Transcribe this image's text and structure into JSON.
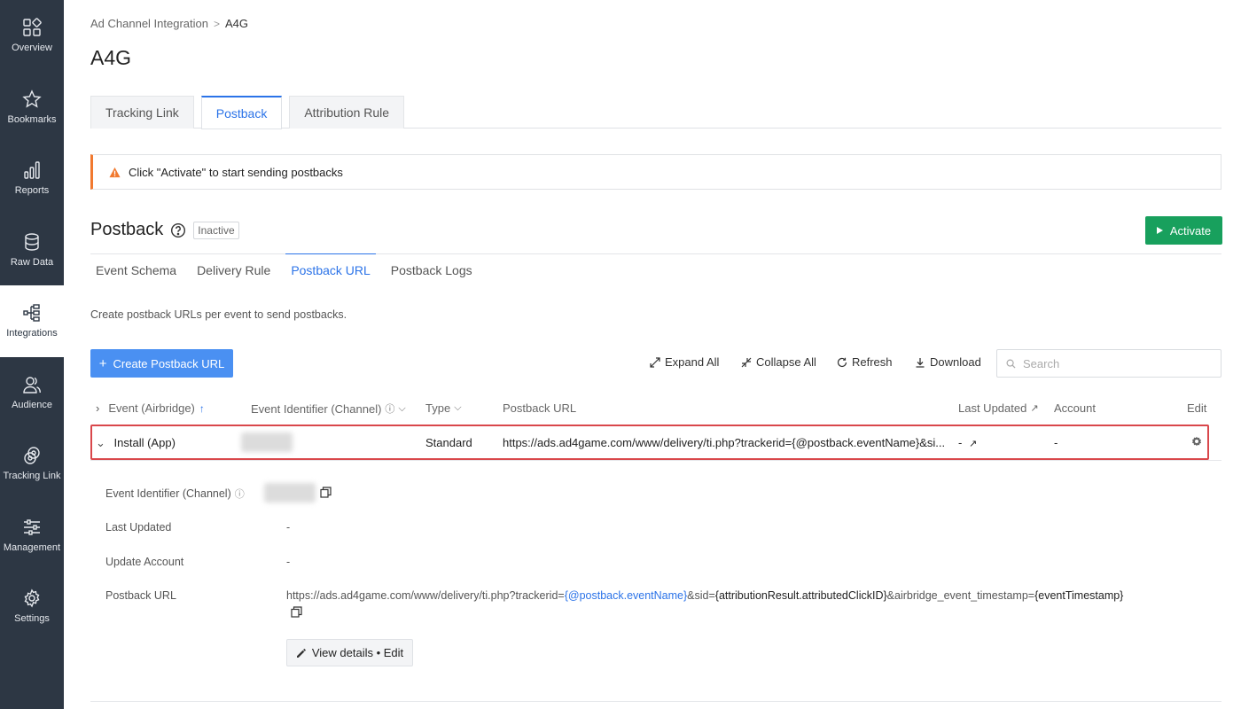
{
  "sidebar": {
    "items": [
      {
        "label": "Overview",
        "icon": "overview-icon"
      },
      {
        "label": "Bookmarks",
        "icon": "star-icon"
      },
      {
        "label": "Reports",
        "icon": "bar-chart-icon"
      },
      {
        "label": "Raw Data",
        "icon": "database-icon"
      },
      {
        "label": "Integrations",
        "icon": "integrations-icon",
        "active": true
      },
      {
        "label": "Audience",
        "icon": "users-icon"
      },
      {
        "label": "Tracking Link",
        "icon": "link-icon"
      },
      {
        "label": "Management",
        "icon": "sliders-icon"
      },
      {
        "label": "Settings",
        "icon": "gear-icon"
      }
    ]
  },
  "breadcrumb": {
    "parent": "Ad Channel Integration",
    "separator": ">",
    "current": "A4G"
  },
  "page_title": "A4G",
  "top_tabs": [
    "Tracking Link",
    "Postback",
    "Attribution Rule"
  ],
  "alert": {
    "text": "Click \"Activate\" to start sending postbacks"
  },
  "postback": {
    "title": "Postback",
    "status": "Inactive",
    "activate_label": "Activate"
  },
  "sub_tabs": [
    "Event Schema",
    "Delivery Rule",
    "Postback URL",
    "Postback Logs"
  ],
  "description": "Create postback URLs per event to send postbacks.",
  "toolbar": {
    "create_label": "Create Postback URL",
    "expand_all": "Expand All",
    "collapse_all": "Collapse All",
    "refresh": "Refresh",
    "download": "Download",
    "search_placeholder": "Search"
  },
  "table": {
    "headers": {
      "event": "Event (Airbridge)",
      "identifier": "Event Identifier (Channel)",
      "type": "Type",
      "url": "Postback URL",
      "last_updated": "Last Updated",
      "account": "Account",
      "edit": "Edit"
    },
    "row": {
      "event": "Install (App)",
      "type": "Standard",
      "url": "https://ads.ad4game.com/www/delivery/ti.php?trackerid={@postback.eventName}&si...",
      "last_updated": "-",
      "account": "-"
    }
  },
  "details": {
    "identifier_label": "Event Identifier (Channel)",
    "last_updated_label": "Last Updated",
    "last_updated_value": "-",
    "update_account_label": "Update Account",
    "update_account_value": "-",
    "postback_url_label": "Postback URL",
    "url_parts": {
      "p1": "https://ads.ad4game.com/www/delivery/ti.php?trackerid=",
      "p2": "{@postback.eventName}",
      "p3": "&sid=",
      "p4": "{attributionResult.attributedClickID}",
      "p5": "&airbridge_event_timestamp=",
      "p6": "{eventTimestamp}"
    },
    "view_edit_label": "View details • Edit"
  },
  "colors": {
    "sidebar_bg": "#2d3744",
    "accent_blue": "#2b73e8",
    "activate_green": "#18a05d",
    "alert_orange": "#f1792f",
    "highlight_red": "#d9474b"
  }
}
